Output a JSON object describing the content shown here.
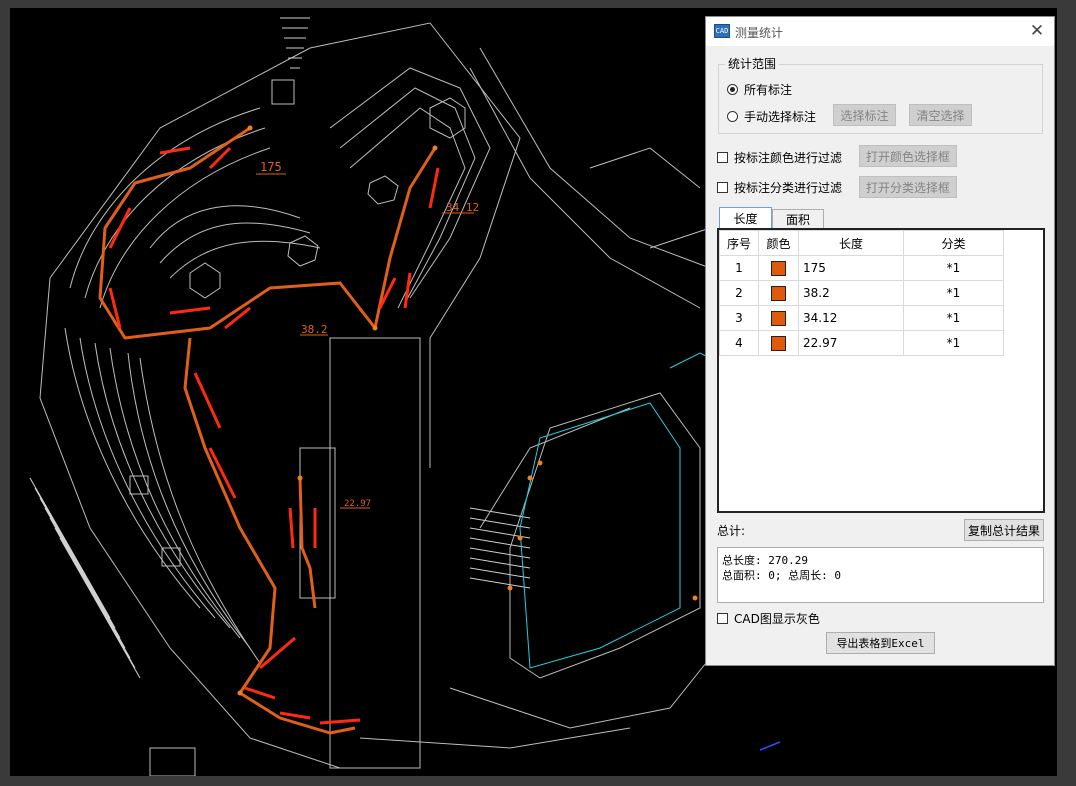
{
  "dialog": {
    "title": "测量统计",
    "app_icon_text": "CAD",
    "close_glyph": "✕",
    "scope": {
      "legend": "统计范围",
      "option_all": "所有标注",
      "option_manual": "手动选择标注",
      "select_button": "选择标注",
      "clear_button": "清空选择"
    },
    "filters": {
      "color_label": "按标注颜色进行过滤",
      "color_button": "打开颜色选择框",
      "category_label": "按标注分类进行过滤",
      "category_button": "打开分类选择框"
    },
    "tabs": {
      "length": "长度",
      "area": "面积"
    },
    "table": {
      "headers": {
        "index": "序号",
        "color": "颜色",
        "length": "长度",
        "category": "分类"
      },
      "swatch_color": "#e05a0c",
      "rows": [
        {
          "index": "1",
          "length": "175",
          "category": "*1"
        },
        {
          "index": "2",
          "length": "38.2",
          "category": "*1"
        },
        {
          "index": "3",
          "length": "34.12",
          "category": "*1"
        },
        {
          "index": "4",
          "length": "22.97",
          "category": "*1"
        }
      ]
    },
    "summary": {
      "label": "总计:",
      "copy_button": "复制总计结果",
      "total_length_line": "总长度: 270.29",
      "total_area_line": "总面积: 0; 总周长: 0"
    },
    "gray_label": "CAD图显示灰色",
    "export_button": "导出表格到Excel"
  },
  "drawing": {
    "labels": {
      "m175": "175",
      "m382": "38.2",
      "m3412": "34.12",
      "m2297": "22.97"
    },
    "colors": {
      "measure": "#e0601a",
      "arrow": "#ff2a10",
      "linework": "#bdbdbd",
      "cyan": "#20d0e0"
    }
  }
}
